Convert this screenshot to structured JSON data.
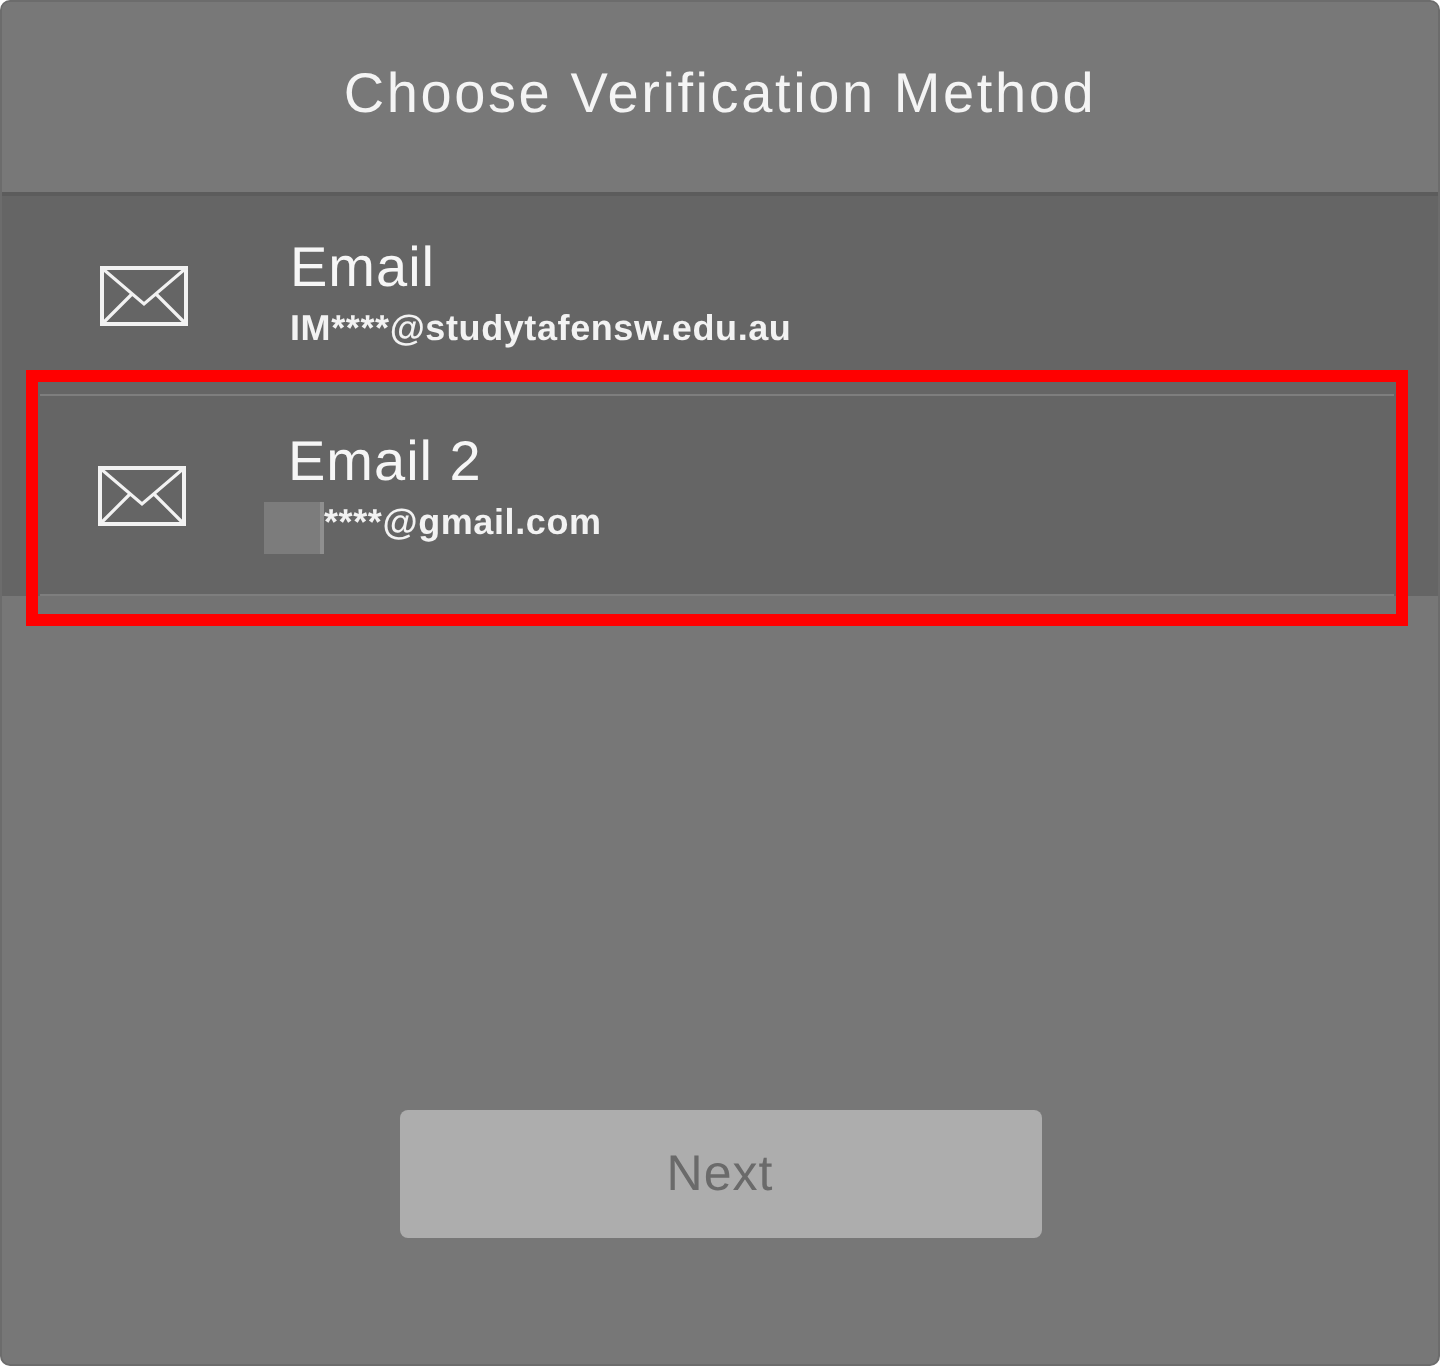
{
  "dialog": {
    "title": "Choose Verification Method"
  },
  "methods": [
    {
      "kind": "email",
      "label": "Email",
      "detail": "IM****@studytafensw.edu.au",
      "redacted": false,
      "selected": false
    },
    {
      "kind": "email",
      "label": "Email 2",
      "detail": "****@gmail.com",
      "redacted": true,
      "selected": true
    }
  ],
  "next_button": {
    "label": "Next",
    "disabled": true
  }
}
